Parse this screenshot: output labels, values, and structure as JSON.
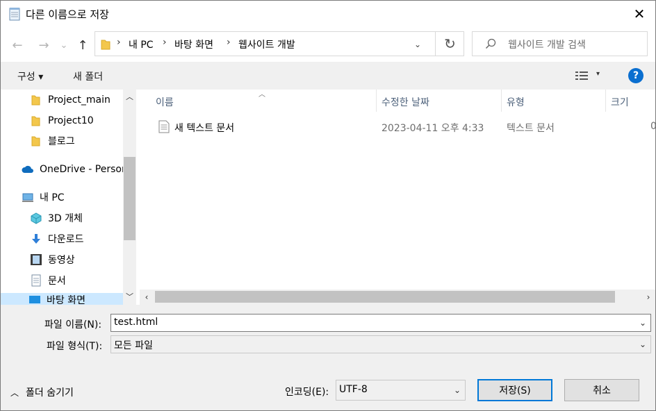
{
  "window": {
    "title": "다른 이름으로 저장",
    "close_glyph": "✕"
  },
  "nav": {
    "back_glyph": "←",
    "forward_glyph": "→",
    "recent_glyph": "⌄",
    "up_glyph": "↑",
    "breadcrumb": [
      "내 PC",
      "바탕 화면",
      "웹사이트 개발"
    ],
    "separator": "›",
    "dropdown_glyph": "⌄",
    "refresh_glyph": "↻",
    "search_placeholder": "웹사이트 개발 검색"
  },
  "toolbar": {
    "organize": "구성 ▾",
    "new_folder": "새 폴더",
    "view_dropdown": "▾",
    "help": "?"
  },
  "navpane": {
    "items": [
      {
        "label": "Project_main",
        "icon": "folder-icon"
      },
      {
        "label": "Project10",
        "icon": "folder-icon"
      },
      {
        "label": "블로그",
        "icon": "folder-icon"
      },
      {
        "label": "OneDrive - Person",
        "icon": "cloud-icon"
      },
      {
        "label": "내 PC",
        "icon": "pc-icon"
      },
      {
        "label": "3D 개체",
        "icon": "cube-icon"
      },
      {
        "label": "다운로드",
        "icon": "download-icon"
      },
      {
        "label": "동영상",
        "icon": "film-icon"
      },
      {
        "label": "문서",
        "icon": "document-icon"
      },
      {
        "label": "바탕 화면",
        "icon": "desktop-icon"
      }
    ],
    "scroll_up": "︿",
    "scroll_down": "﹀"
  },
  "filelist": {
    "columns": [
      "이름",
      "수정한 날짜",
      "유형",
      "크기"
    ],
    "sort_caret": "︿",
    "rows": [
      {
        "name": "새 텍스트 문서",
        "modified": "2023-04-11 오후 4:33",
        "type": "텍스트 문서",
        "size": "0"
      }
    ],
    "scroll_left": "‹",
    "scroll_right": "›"
  },
  "fields": {
    "filename_label": "파일 이름(N):",
    "filename_value": "test.html",
    "filetype_label": "파일 형식(T):",
    "filetype_value": "모든 파일",
    "encoding_label": "인코딩(E):",
    "encoding_value": "UTF-8",
    "dropdown_glyph": "⌄"
  },
  "footer": {
    "hide_folders": "폴더 숨기기",
    "hide_caret": "︿",
    "save": "저장(S)",
    "cancel": "취소"
  }
}
